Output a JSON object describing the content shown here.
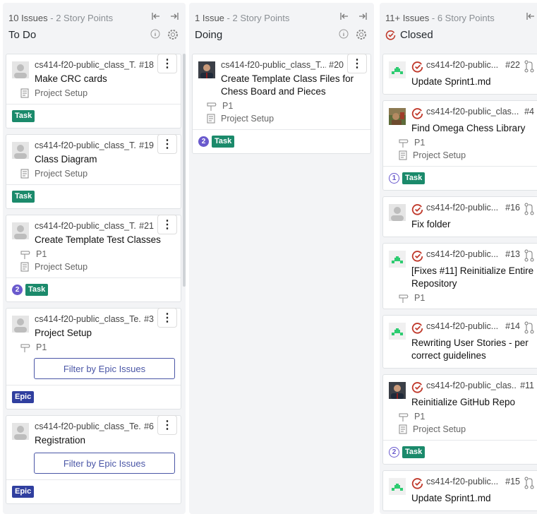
{
  "pipelines": [
    {
      "stat_issues": "10 Issues",
      "stat_points": " - 2 Story Points",
      "name": "To Do",
      "cards": [
        {
          "repo": "cs414-f20-public_class_T...",
          "num": "#18",
          "title": "Make CRC cards",
          "priority": "",
          "epic": "Project Setup",
          "tag": "Task",
          "badge": "",
          "epic_button": ""
        },
        {
          "repo": "cs414-f20-public_class_T...",
          "num": "#19",
          "title": "Class Diagram",
          "priority": "",
          "epic": "Project Setup",
          "tag": "Task",
          "badge": "",
          "epic_button": ""
        },
        {
          "repo": "cs414-f20-public_class_T...",
          "num": "#21",
          "title": "Create Template Test Classes",
          "priority": "P1",
          "epic": "Project Setup",
          "tag": "Task",
          "badge": "2",
          "epic_button": ""
        },
        {
          "repo": "cs414-f20-public_class_Te...",
          "num": "#3",
          "title": "Project Setup",
          "priority": "P1",
          "epic": "",
          "tag": "Epic",
          "badge": "",
          "epic_button": "Filter by Epic Issues"
        },
        {
          "repo": "cs414-f20-public_class_Te...",
          "num": "#6",
          "title": "Registration",
          "priority": "",
          "epic": "",
          "tag": "Epic",
          "badge": "",
          "epic_button": "Filter by Epic Issues"
        }
      ]
    },
    {
      "stat_issues": "1 Issue",
      "stat_points": " - 2 Story Points",
      "name": "Doing",
      "cards": [
        {
          "repo": "cs414-f20-public_class_T...",
          "num": "#20",
          "title": "Create Template Class Files for Chess Board and Pieces",
          "priority": "P1",
          "epic": "Project Setup",
          "tag": "Task",
          "badge": "2"
        }
      ]
    },
    {
      "stat_issues": "11+ Issues",
      "stat_points": " - 6 Story Points",
      "name": "Closed",
      "cards": [
        {
          "repo": "cs414-f20-public...",
          "num": "#22",
          "title": "Update Sprint1.md",
          "avatar": "green"
        },
        {
          "repo": "cs414-f20-public_clas...",
          "num": "#4",
          "title": "Find Omega Chess Library",
          "priority": "P1",
          "epic": "Project Setup",
          "tag": "Task",
          "badge": "1",
          "avatar": "photo2"
        },
        {
          "repo": "cs414-f20-public...",
          "num": "#16",
          "title": "Fix folder",
          "avatar": "gray"
        },
        {
          "repo": "cs414-f20-public...",
          "num": "#13",
          "title": "[Fixes #11] Reinitialize Entire Repository",
          "priority": "P1",
          "avatar": "green"
        },
        {
          "repo": "cs414-f20-public...",
          "num": "#14",
          "title": "Rewriting User Stories - per correct guidelines",
          "avatar": "green"
        },
        {
          "repo": "cs414-f20-public_clas...",
          "num": "#11",
          "title": "Reinitialize GitHub Repo",
          "priority": "P1",
          "epic": "Project Setup",
          "tag": "Task",
          "badge": "2",
          "avatar": "photo"
        },
        {
          "repo": "cs414-f20-public...",
          "num": "#15",
          "title": "Update Sprint1.md",
          "avatar": "green"
        }
      ]
    }
  ],
  "colors": {
    "task": "#1b8a6b",
    "epic": "#303f9f",
    "closed": "#c0392b",
    "badge": "#6a5acd"
  }
}
